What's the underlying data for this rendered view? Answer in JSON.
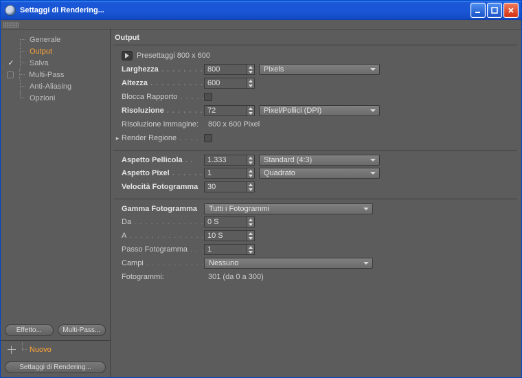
{
  "window_title": "Settaggi di Rendering...",
  "sidebar": {
    "items": [
      {
        "label": "Generale"
      },
      {
        "label": "Output",
        "selected": true
      },
      {
        "label": "Salva",
        "checked": true
      },
      {
        "label": "Multi-Pass",
        "checked_empty": true
      },
      {
        "label": "Anti-Aliasing"
      },
      {
        "label": "Opzioni"
      }
    ],
    "effect_btn": "Effetto...",
    "multipass_btn": "Multi-Pass...",
    "new_label": "Nuovo",
    "footer_btn": "Settaggi di Rendering..."
  },
  "panel": {
    "title": "Output",
    "preset_label": "Presettaggi 800 x 600",
    "width_label": "Larghezza",
    "width_value": "800",
    "width_unit_select": "Pixels",
    "height_label": "Altezza",
    "height_value": "600",
    "lockratio_label": "Blocca Rapporto",
    "resolution_label": "Risoluzione",
    "resolution_value": "72",
    "resolution_unit_select": "Pixel/Pollici (DPI)",
    "imgres_label": "RIsoluzione Immagine:",
    "imgres_value": "800 x 600 Pixel",
    "renderregion_label": "Render Regione",
    "filmaspect_label": "Aspetto Pellicola",
    "filmaspect_value": "1.333",
    "filmaspect_select": "Standard (4:3)",
    "pixaspect_label": "Aspetto Pixel",
    "pixaspect_value": "1",
    "pixaspect_select": "Quadrato",
    "fps_label": "Velocità Fotogramma",
    "fps_value": "30",
    "framerange_label": "Gamma Fotogramma",
    "framerange_select": "Tutti i Fotogrammi",
    "from_label": "Da",
    "from_value": "0 S",
    "to_label": "A",
    "to_value": "10 S",
    "step_label": "Passo Fotogramma",
    "step_value": "1",
    "fields_label": "Campi",
    "fields_select": "Nessuno",
    "frames_label": "Fotogrammi:",
    "frames_value": "301 (da 0 a 300)"
  }
}
